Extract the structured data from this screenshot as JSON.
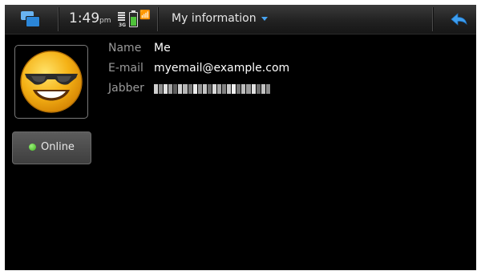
{
  "statusbar": {
    "time": "1:49",
    "ampm": "pm",
    "network": "3G",
    "title": "My information",
    "icons": {
      "switcher": "task-switcher-icon",
      "battery": "battery-icon",
      "signal": "signal-icon",
      "wifi": "wifi-icon",
      "back": "back-arrow-icon"
    },
    "accent": "#47a3f0"
  },
  "profile": {
    "presence_label": "Online",
    "presence_color": "#3fb21d",
    "avatar": "sunglasses-smiley-avatar"
  },
  "details": [
    {
      "key": "Name",
      "value": "Me"
    },
    {
      "key": "E-mail",
      "value": "myemail@example.com"
    },
    {
      "key": "Jabber",
      "value": ""
    }
  ]
}
